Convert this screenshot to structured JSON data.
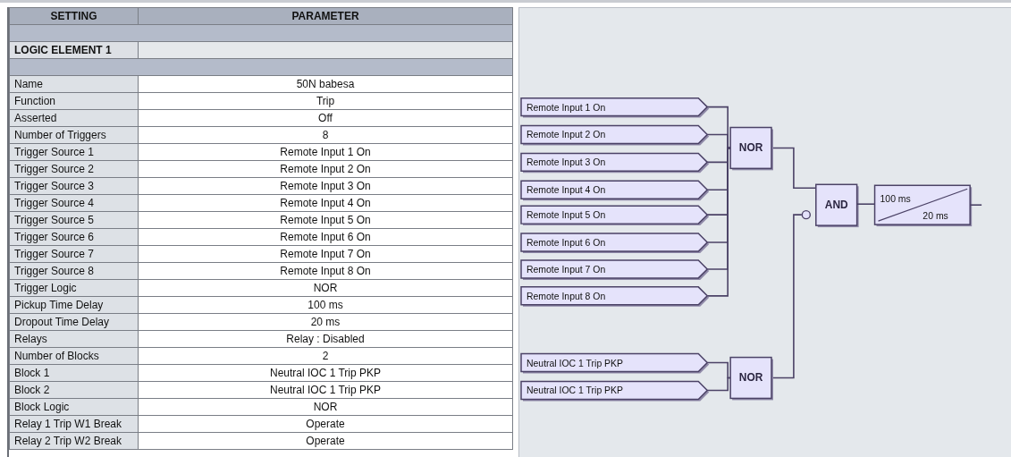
{
  "table": {
    "columns": [
      "SETTING",
      "PARAMETER"
    ],
    "rows": [
      {
        "kind": "band"
      },
      {
        "kind": "section",
        "setting": "LOGIC ELEMENT 1"
      },
      {
        "kind": "band"
      },
      {
        "kind": "row",
        "setting": "Name",
        "parameter": "50N babesa"
      },
      {
        "kind": "row",
        "setting": "Function",
        "parameter": "Trip"
      },
      {
        "kind": "row",
        "setting": "Asserted",
        "parameter": "Off"
      },
      {
        "kind": "row",
        "setting": "Number of Triggers",
        "parameter": "8"
      },
      {
        "kind": "row",
        "setting": "Trigger Source 1",
        "parameter": "Remote Input 1 On"
      },
      {
        "kind": "row",
        "setting": "Trigger Source 2",
        "parameter": "Remote Input 2 On"
      },
      {
        "kind": "row",
        "setting": "Trigger Source 3",
        "parameter": "Remote Input 3 On"
      },
      {
        "kind": "row",
        "setting": "Trigger Source 4",
        "parameter": "Remote Input 4 On"
      },
      {
        "kind": "row",
        "setting": "Trigger Source 5",
        "parameter": "Remote Input 5 On"
      },
      {
        "kind": "row",
        "setting": "Trigger Source 6",
        "parameter": "Remote Input 6 On"
      },
      {
        "kind": "row",
        "setting": "Trigger Source 7",
        "parameter": "Remote Input 7 On"
      },
      {
        "kind": "row",
        "setting": "Trigger Source 8",
        "parameter": "Remote Input 8 On"
      },
      {
        "kind": "row",
        "setting": "Trigger Logic",
        "parameter": "NOR"
      },
      {
        "kind": "row",
        "setting": "Pickup Time Delay",
        "parameter": "100 ms"
      },
      {
        "kind": "row",
        "setting": "Dropout Time Delay",
        "parameter": "20 ms"
      },
      {
        "kind": "row",
        "setting": "Relays",
        "parameter": "Relay : Disabled"
      },
      {
        "kind": "row",
        "setting": "Number of Blocks",
        "parameter": "2"
      },
      {
        "kind": "row",
        "setting": "Block 1",
        "parameter": "Neutral IOC 1 Trip PKP"
      },
      {
        "kind": "row",
        "setting": "Block 2",
        "parameter": "Neutral IOC 1 Trip PKP"
      },
      {
        "kind": "row",
        "setting": "Block Logic",
        "parameter": "NOR"
      },
      {
        "kind": "row",
        "setting": "Relay 1 Trip W1 Break",
        "parameter": "Operate"
      },
      {
        "kind": "row",
        "setting": "Relay 2 Trip W2 Break",
        "parameter": "Operate"
      }
    ]
  },
  "diagram": {
    "groups": [
      {
        "gate": "NOR",
        "negated": false,
        "inputs": [
          "Remote Input 1 On",
          "Remote Input 2 On",
          "Remote Input 3 On",
          "Remote Input 4 On",
          "Remote Input 5 On",
          "Remote Input 6 On",
          "Remote Input 7 On",
          "Remote Input 8 On"
        ]
      },
      {
        "gate": "NOR",
        "negated": true,
        "inputs": [
          "Neutral IOC 1 Trip PKP",
          "Neutral IOC 1 Trip PKP"
        ]
      }
    ],
    "combine_gate": "AND",
    "timer": {
      "pickup": "100 ms",
      "dropout": "20 ms"
    }
  }
}
